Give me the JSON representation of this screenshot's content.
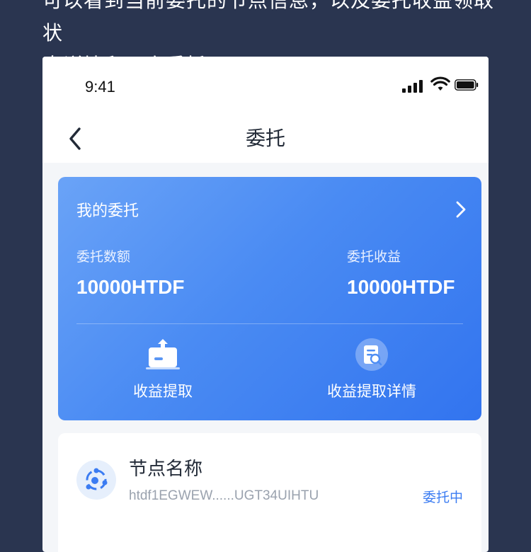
{
  "caption": {
    "line1": "可以看到当前委托的节点信息，以及委托收益领取状",
    "line2": "态详情和再次委托"
  },
  "status_bar": {
    "time": "9:41"
  },
  "nav": {
    "title": "委托",
    "back_icon": "chevron-left-icon"
  },
  "summary": {
    "title": "我的委托",
    "amount_label": "委托数额",
    "amount_value": "10000HTDF",
    "earnings_label": "委托收益",
    "earnings_value": "10000HTDF",
    "actions": [
      {
        "label": "收益提取",
        "icon": "withdraw-box-icon"
      },
      {
        "label": "收益提取详情",
        "icon": "document-search-icon"
      }
    ],
    "gradient": [
      "#6aa3f7",
      "#3274ef"
    ]
  },
  "node": {
    "name": "节点名称",
    "address": "htdf1EGWEW......UGT34UIHTU",
    "status": "委托中",
    "status_color": "#3b7cf2"
  }
}
